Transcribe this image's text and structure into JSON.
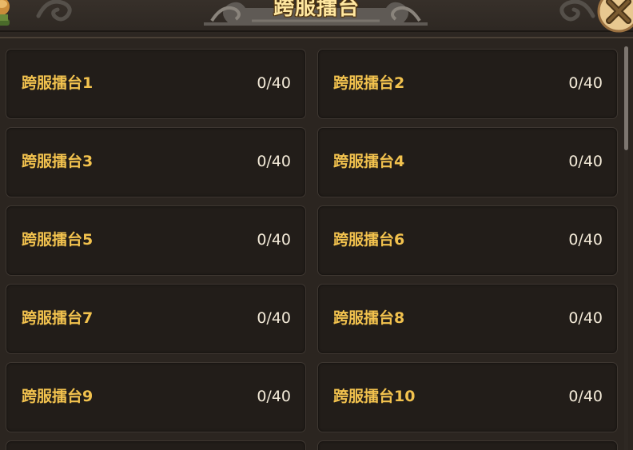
{
  "header": {
    "title": "跨服擂台",
    "icons": [
      "pot-icon",
      "close-icon"
    ]
  },
  "colors": {
    "background": "#2b2520",
    "slot_background": "#221d19",
    "slot_name": "#f2c24e",
    "slot_count": "#f3ead8",
    "title": "#ffe7a0"
  },
  "arenas": [
    {
      "name": "跨服擂台1",
      "count": "0/40"
    },
    {
      "name": "跨服擂台2",
      "count": "0/40"
    },
    {
      "name": "跨服擂台3",
      "count": "0/40"
    },
    {
      "name": "跨服擂台4",
      "count": "0/40"
    },
    {
      "name": "跨服擂台5",
      "count": "0/40"
    },
    {
      "name": "跨服擂台6",
      "count": "0/40"
    },
    {
      "name": "跨服擂台7",
      "count": "0/40"
    },
    {
      "name": "跨服擂台8",
      "count": "0/40"
    },
    {
      "name": "跨服擂台9",
      "count": "0/40"
    },
    {
      "name": "跨服擂台10",
      "count": "0/40"
    }
  ]
}
